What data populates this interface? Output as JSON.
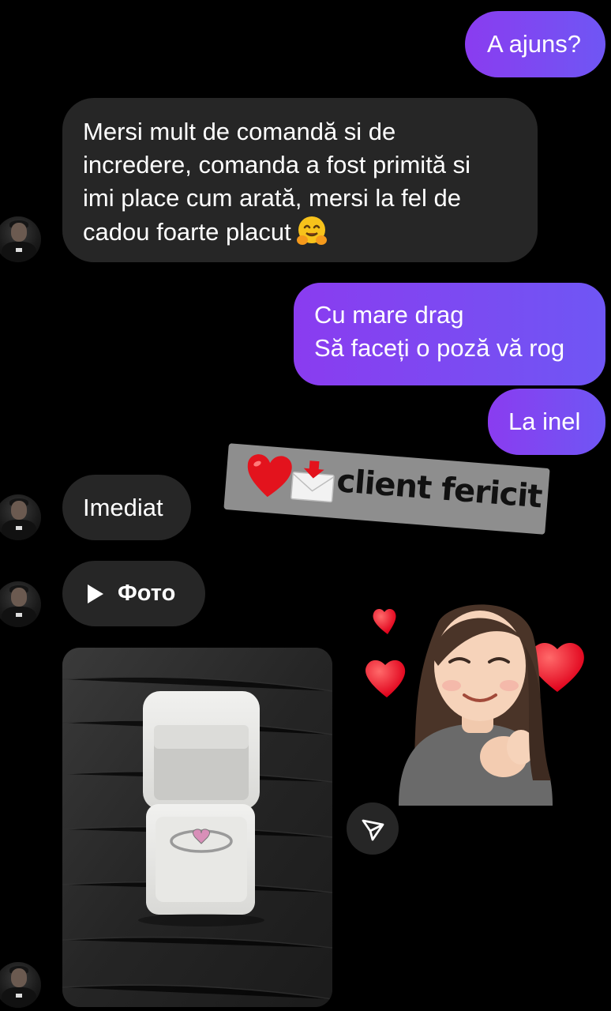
{
  "messages": {
    "m1": "A ajuns?",
    "m2": [
      "Mersi mult de comandă si de",
      "incredere, comanda a fost primită si",
      "imi place cum arată, mersi la fel de",
      "cadou foarte placut"
    ],
    "m3": [
      "Cu mare drag",
      "Să faceți o poză vă rog"
    ],
    "m4": "La inel",
    "m5": "Imediat",
    "m6": "Фото"
  },
  "sticker_text": "client fericit",
  "icons": {
    "hug": "hugging-face-emoji",
    "heart": "red-heart-emoji",
    "envelope": "envelope-with-arrow-emoji",
    "share": "send-icon",
    "play": "play-icon"
  },
  "colors": {
    "background": "#000000",
    "incoming_bubble": "#262626",
    "outgoing_start": "#8a3cf0",
    "outgoing_end": "#6f56f4",
    "sticker_bg": "#8e8e8e"
  }
}
